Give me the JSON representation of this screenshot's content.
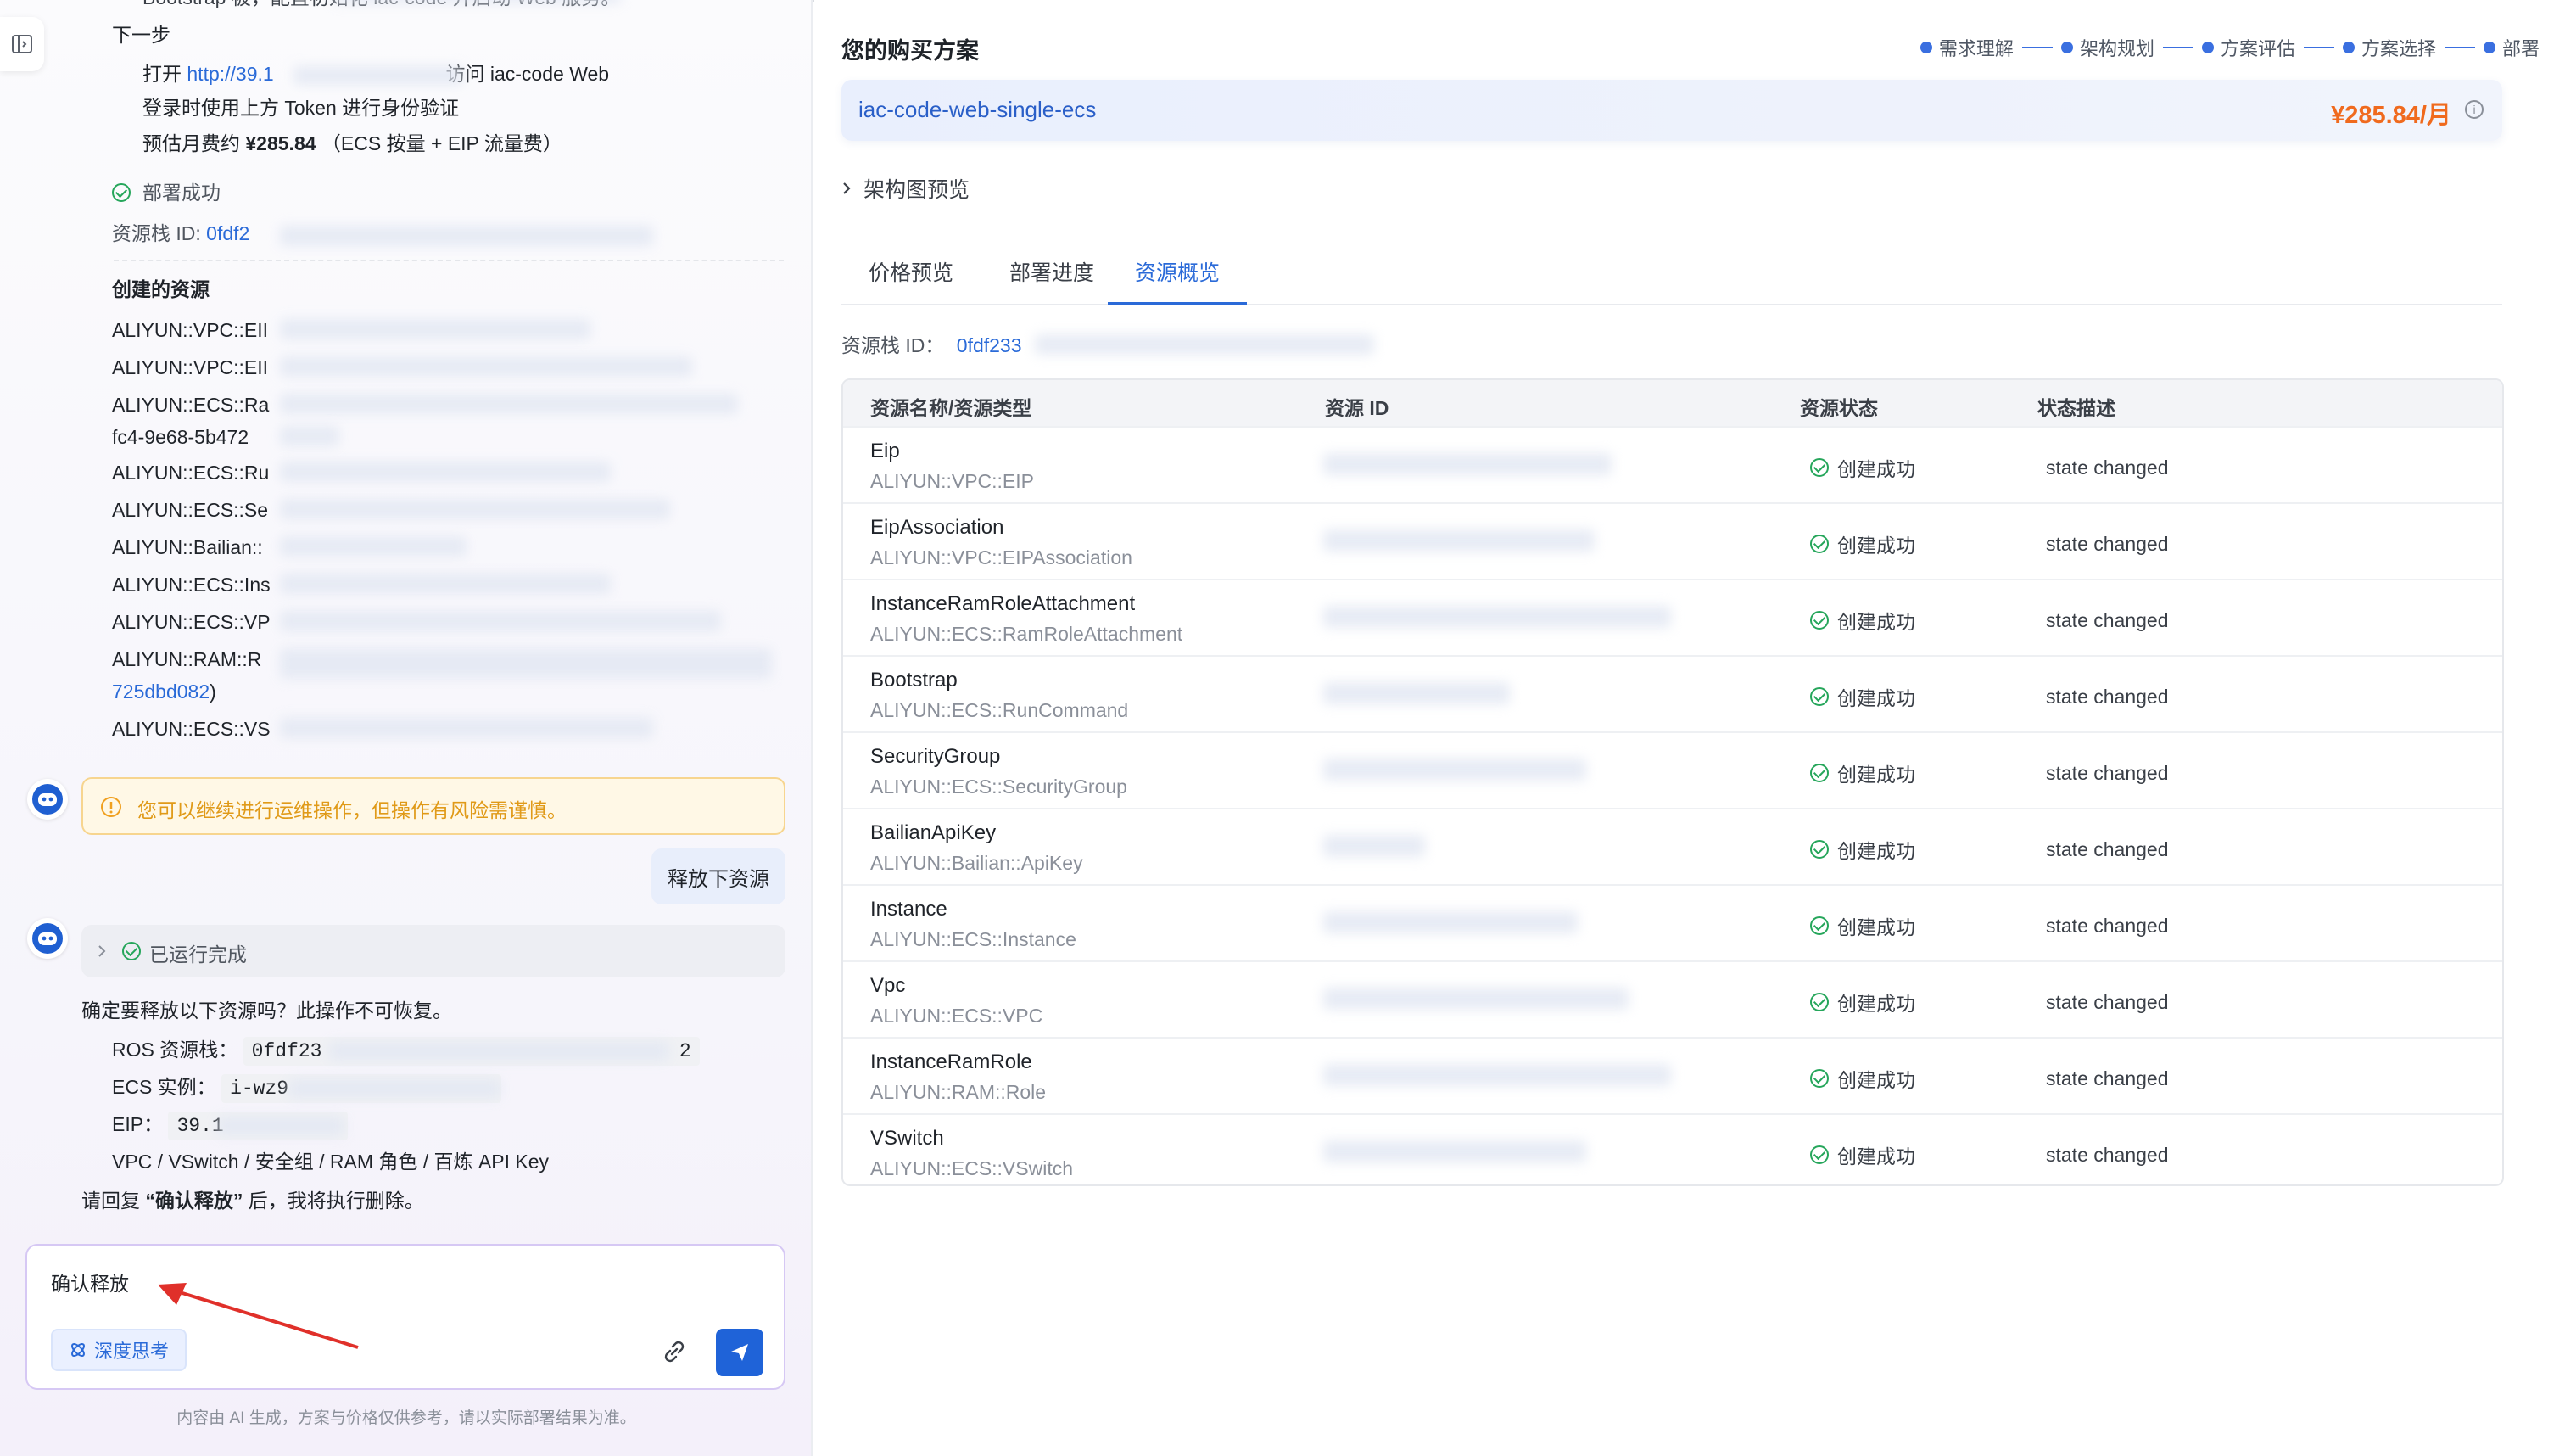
{
  "left": {
    "partial_top": "Bootstrap 被，配置初始化 iac-code 并启动 Web 服务。",
    "next_step_title": "下一步",
    "open_prefix": "打开",
    "open_link": "http://39.1",
    "open_suffix": "访问 iac-code Web",
    "token_line": "登录时使用上方 Token 进行身份验证",
    "cost_prefix": "预估月费约",
    "cost_value": "¥285.84",
    "cost_suffix": "（ECS 按量 + EIP 流量费）",
    "deploy_status": "部署成功",
    "stack_label": "资源栈 ID:",
    "stack_value": "0fdf2",
    "resources_title": "创建的资源",
    "resources": [
      "ALIYUN::VPC::EII",
      "ALIYUN::VPC::EII",
      "ALIYUN::ECS::Ra",
      "fc4-9e68-5b472",
      "ALIYUN::ECS::Ru",
      "ALIYUN::ECS::Se",
      "ALIYUN::Bailian::",
      "ALIYUN::ECS::Ins",
      "ALIYUN::ECS::VP",
      "ALIYUN::RAM::R",
      "725dbd082",
      "ALIYUN::ECS::VS"
    ],
    "warning": "您可以继续进行运维操作，但操作有风险需谨慎。",
    "user_message": "释放下资源",
    "run_status": "已运行完成",
    "confirm_question": "确定要释放以下资源吗？此操作不可恢复。",
    "ros_label": "ROS 资源栈：",
    "ros_value": "0fdf23",
    "ros_tail": "2",
    "ecs_label": "ECS 实例：",
    "ecs_value": "i-wz9",
    "eip_label": "EIP：",
    "eip_value": "39.1",
    "other_resources": "VPC / VSwitch / 安全组 / RAM 角色 / 百炼 API Key",
    "reply_prefix": "请回复",
    "reply_keyword": "“确认释放”",
    "reply_suffix": "后，我将执行删除。",
    "input_value": "确认释放",
    "deep_think": "深度思考",
    "footer": "内容由 AI 生成，方案与价格仅供参考，请以实际部署结果为准。"
  },
  "right": {
    "title": "您的购买方案",
    "steps": [
      "需求理解",
      "架构规划",
      "方案评估",
      "方案选择",
      "部署"
    ],
    "plan_name": "iac-code-web-single-ecs",
    "plan_price": "¥285.84/月",
    "info_icon": "i",
    "arch_preview": "架构图预览",
    "tabs": [
      "价格预览",
      "部署进度",
      "资源概览"
    ],
    "active_tab": 2,
    "stack_label": "资源栈 ID：",
    "stack_value": "0fdf233",
    "columns": [
      "资源名称/资源类型",
      "资源 ID",
      "资源状态",
      "状态描述"
    ],
    "rows": [
      {
        "name": "Eip",
        "type": "ALIYUN::VPC::EIP",
        "status": "创建成功",
        "desc": "state changed"
      },
      {
        "name": "EipAssociation",
        "type": "ALIYUN::VPC::EIPAssociation",
        "status": "创建成功",
        "desc": "state changed"
      },
      {
        "name": "InstanceRamRoleAttachment",
        "type": "ALIYUN::ECS::RamRoleAttachment",
        "status": "创建成功",
        "desc": "state changed"
      },
      {
        "name": "Bootstrap",
        "type": "ALIYUN::ECS::RunCommand",
        "status": "创建成功",
        "desc": "state changed"
      },
      {
        "name": "SecurityGroup",
        "type": "ALIYUN::ECS::SecurityGroup",
        "status": "创建成功",
        "desc": "state changed"
      },
      {
        "name": "BailianApiKey",
        "type": "ALIYUN::Bailian::ApiKey",
        "status": "创建成功",
        "desc": "state changed"
      },
      {
        "name": "Instance",
        "type": "ALIYUN::ECS::Instance",
        "status": "创建成功",
        "desc": "state changed"
      },
      {
        "name": "Vpc",
        "type": "ALIYUN::ECS::VPC",
        "status": "创建成功",
        "desc": "state changed"
      },
      {
        "name": "InstanceRamRole",
        "type": "ALIYUN::RAM::Role",
        "status": "创建成功",
        "desc": "state changed"
      },
      {
        "name": "VSwitch",
        "type": "ALIYUN::ECS::VSwitch",
        "status": "创建成功",
        "desc": "state changed"
      }
    ]
  },
  "colors": {
    "accent": "#2a6ad8",
    "price": "#f06a1d",
    "success": "#26a65b",
    "warning_bg": "#fff8e6"
  }
}
